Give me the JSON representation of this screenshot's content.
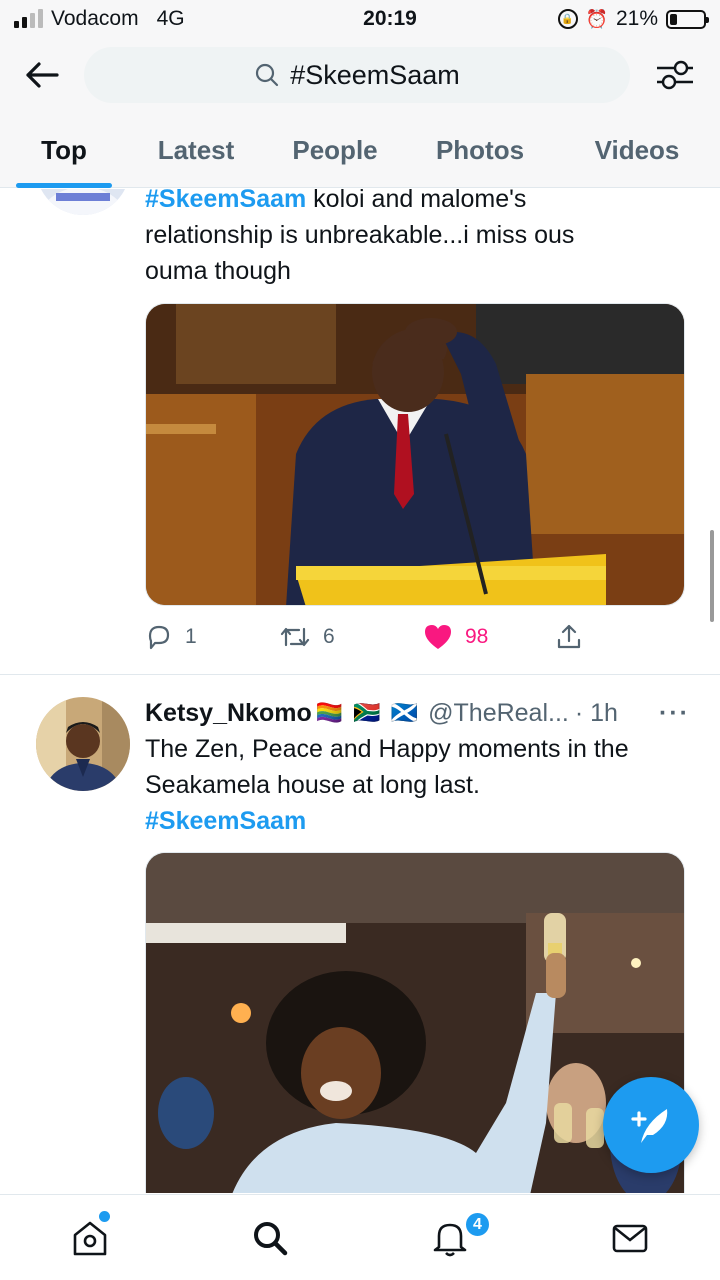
{
  "status_bar": {
    "carrier": "Vodacom",
    "network": "4G",
    "time": "20:19",
    "battery": "21%",
    "battery_level": 0.21
  },
  "search": {
    "query": "#SkeemSaam",
    "back_icon": "arrow-left-icon",
    "filter_icon": "sliders-icon"
  },
  "tabs": [
    {
      "label": "Top",
      "active": true
    },
    {
      "label": "Latest",
      "active": false
    },
    {
      "label": "People",
      "active": false
    },
    {
      "label": "Photos",
      "active": false
    },
    {
      "label": "Videos",
      "active": false
    }
  ],
  "tweets": [
    {
      "hashtag": "#SkeemSaam",
      "text_line1": " koloi and malome's",
      "text_line2": "relationship is unbreakable...i miss ous",
      "text_line3": "ouma though",
      "media_alt": "man in suit scratching head at podium",
      "stats": {
        "replies": "1",
        "retweets": "6",
        "likes": "98"
      },
      "liked": true,
      "like_color": "#f91880"
    },
    {
      "author": "Ketsy_Nkomo",
      "flags": "🏳️‍🌈 🇿🇦 🏴󠁧󠁢󠁳󠁣󠁴󠁿",
      "handle": "@TheReal...",
      "time": "· 1h",
      "more": "···",
      "text_line1": "The Zen, Peace and Happy moments in the",
      "text_line2": "Seakamela house at long last.",
      "hashtag": "#SkeemSaam",
      "media_alt": "woman raising champagne glass"
    }
  ],
  "bottom_nav": {
    "home_icon": "home-icon",
    "search_icon": "search-icon",
    "notifications_icon": "bell-icon",
    "notifications_count": "4",
    "messages_icon": "mail-icon"
  },
  "compose_icon": "compose-feather-icon",
  "accent": "#1d9bf0"
}
